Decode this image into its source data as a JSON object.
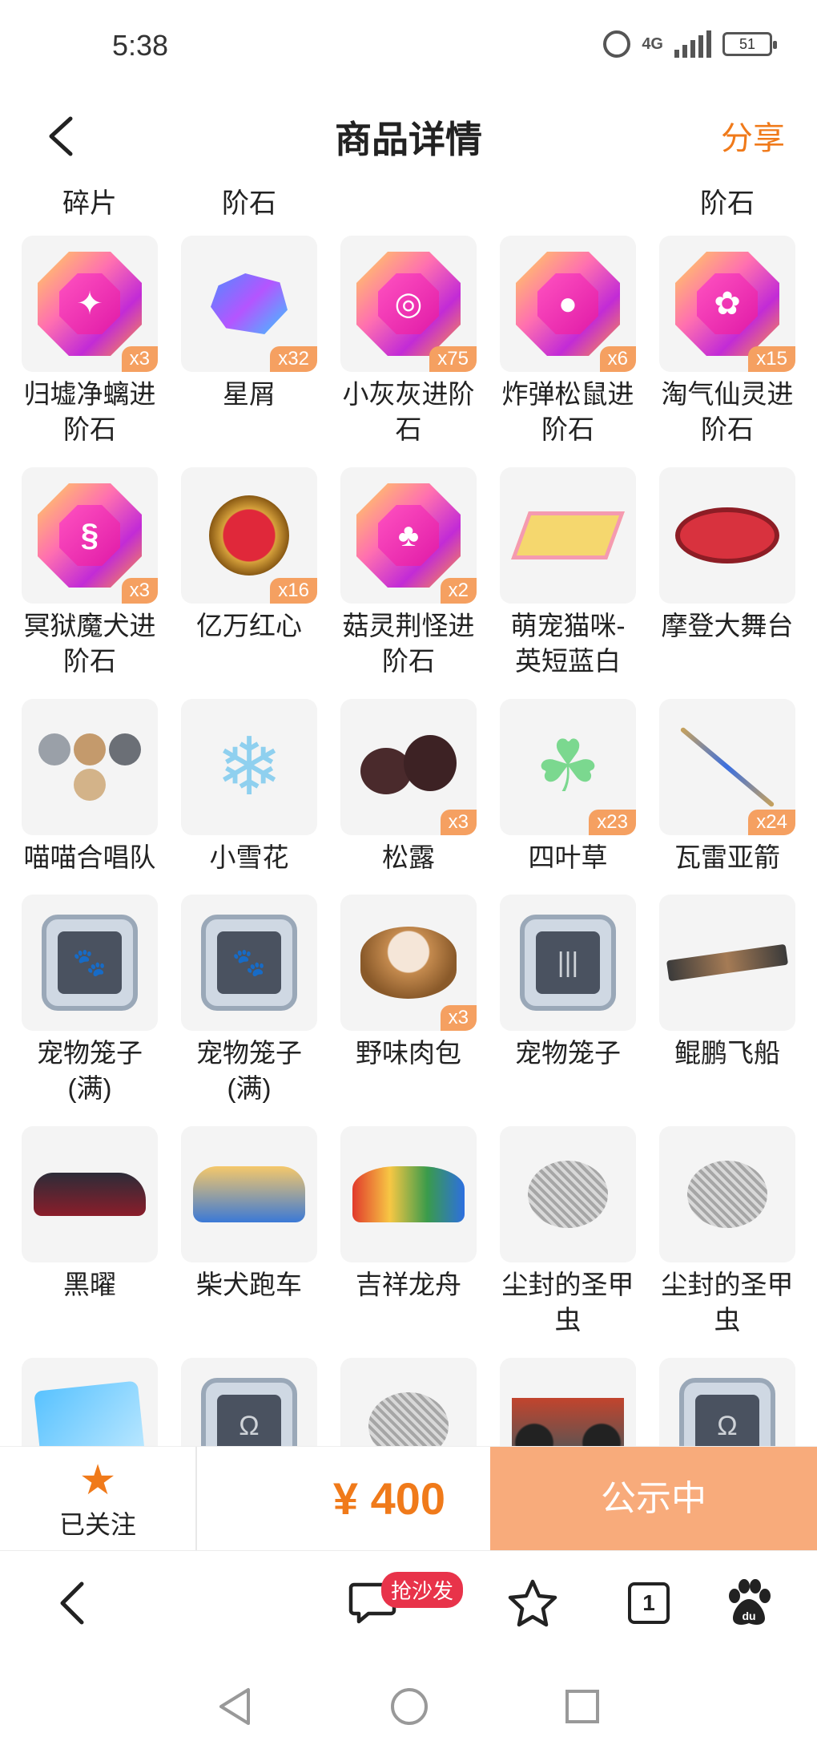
{
  "status": {
    "time": "5:38",
    "network": "4G",
    "battery": "51"
  },
  "header": {
    "title": "商品详情",
    "share": "分享"
  },
  "fragment_labels": [
    {
      "text": "碎片",
      "col": 0
    },
    {
      "text": "阶石",
      "col": 1
    },
    {
      "text": "阶石",
      "col": 4
    }
  ],
  "items": [
    {
      "name": "归墟净螭进阶石",
      "count": "x3",
      "kind": "gem",
      "glyph": "✦"
    },
    {
      "name": "星屑",
      "count": "x32",
      "kind": "shard"
    },
    {
      "name": "小灰灰进阶石",
      "count": "x75",
      "kind": "gem",
      "glyph": "◎"
    },
    {
      "name": "炸弹松鼠进阶石",
      "count": "x6",
      "kind": "gem",
      "glyph": "●"
    },
    {
      "name": "淘气仙灵进阶石",
      "count": "x15",
      "kind": "gem",
      "glyph": "✿"
    },
    {
      "name": "冥狱魔犬进阶石",
      "count": "x3",
      "kind": "gem",
      "glyph": "§"
    },
    {
      "name": "亿万红心",
      "count": "x16",
      "kind": "heart"
    },
    {
      "name": "菇灵荆怪进阶石",
      "count": "x2",
      "kind": "gem",
      "glyph": "♣"
    },
    {
      "name": "萌宠猫咪-英短蓝白",
      "count": "",
      "kind": "scene"
    },
    {
      "name": "摩登大舞台",
      "count": "",
      "kind": "stage"
    },
    {
      "name": "喵喵合唱队",
      "count": "",
      "kind": "cats"
    },
    {
      "name": "小雪花",
      "count": "",
      "kind": "snow"
    },
    {
      "name": "松露",
      "count": "x3",
      "kind": "truffle"
    },
    {
      "name": "四叶草",
      "count": "x23",
      "kind": "clover"
    },
    {
      "name": "瓦雷亚箭",
      "count": "x24",
      "kind": "arrow"
    },
    {
      "name": "宠物笼子(满)",
      "count": "",
      "kind": "cage",
      "glyph": "🐾"
    },
    {
      "name": "宠物笼子(满)",
      "count": "",
      "kind": "cage",
      "glyph": "🐾"
    },
    {
      "name": "野味肉包",
      "count": "x3",
      "kind": "bun"
    },
    {
      "name": "宠物笼子",
      "count": "",
      "kind": "cage",
      "glyph": "|||"
    },
    {
      "name": "鲲鹏飞船",
      "count": "",
      "kind": "ship"
    },
    {
      "name": "黑曜",
      "count": "",
      "kind": "car"
    },
    {
      "name": "柴犬跑车",
      "count": "",
      "kind": "dogcar"
    },
    {
      "name": "吉祥龙舟",
      "count": "",
      "kind": "dragon"
    },
    {
      "name": "尘封的圣甲虫",
      "count": "",
      "kind": "beetle"
    },
    {
      "name": "尘封的圣甲虫",
      "count": "",
      "kind": "beetle"
    },
    {
      "name": "",
      "count": "",
      "kind": "card"
    },
    {
      "name": "",
      "count": "",
      "kind": "cage",
      "glyph": "Ω"
    },
    {
      "name": "",
      "count": "",
      "kind": "beetle"
    },
    {
      "name": "",
      "count": "",
      "kind": "bike"
    },
    {
      "name": "",
      "count": "",
      "kind": "cage",
      "glyph": "Ω"
    }
  ],
  "bottom": {
    "follow_label": "已关注",
    "price": "¥ 400",
    "cta": "公示中"
  },
  "browser": {
    "sofa_badge": "抢沙发",
    "tab_count": "1"
  },
  "colors": {
    "accent": "#f07a1a",
    "cta_bg": "#f8ab7b",
    "badge": "#f5a061"
  }
}
